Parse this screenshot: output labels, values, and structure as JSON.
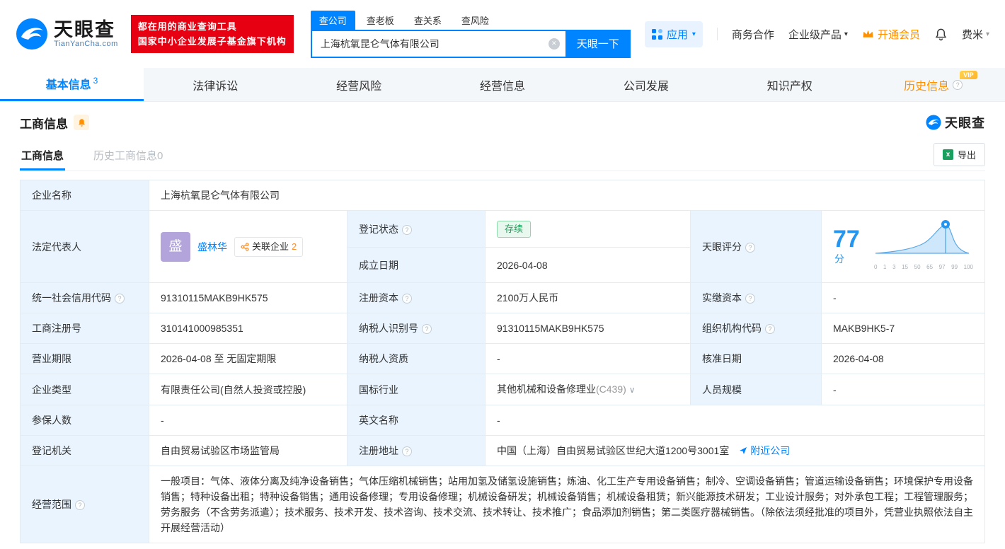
{
  "icons": {
    "caret_down": "▾",
    "chevron_down": "∨",
    "clear": "✕",
    "question": "?",
    "excel_x": "x"
  },
  "colors": {
    "accent_blue": "#0084ff",
    "banner_red": "#e60012",
    "vip_orange": "#ff9000",
    "status_green": "#1fa15a",
    "label_bg": "#e9f4fe"
  },
  "brand": {
    "name": "天眼查",
    "domain": "TianYanCha.com",
    "banner_line1": "都在用的商业查询工具",
    "banner_line2": "国家中小企业发展子基金旗下机构"
  },
  "search": {
    "tabs": [
      "查公司",
      "查老板",
      "查关系",
      "查风险"
    ],
    "value": "上海杭氧昆仑气体有限公司",
    "button": "天眼一下"
  },
  "topnav": {
    "apps": "应用",
    "cooperation": "商务合作",
    "enterprise": "企业级产品",
    "vip": "开通会员",
    "user": "费米"
  },
  "nav_tabs": [
    {
      "label": "基本信息",
      "badge": "3"
    },
    {
      "label": "法律诉讼"
    },
    {
      "label": "经营风险"
    },
    {
      "label": "经营信息"
    },
    {
      "label": "公司发展"
    },
    {
      "label": "知识产权"
    },
    {
      "label": "历史信息",
      "vip": "VIP"
    }
  ],
  "section": {
    "title": "工商信息",
    "subtabs": [
      "工商信息",
      "历史工商信息0"
    ],
    "export_label": "导出"
  },
  "fields": {
    "company_name": {
      "label": "企业名称",
      "value": "上海杭氧昆仑气体有限公司"
    },
    "legal_rep": {
      "label": "法定代表人",
      "name": "盛林华",
      "avatar": "盛",
      "related_label": "关联企业",
      "related_count": "2"
    },
    "reg_status": {
      "label": "登记状态",
      "value": "存续"
    },
    "establish_date": {
      "label": "成立日期",
      "value": "2026-04-08"
    },
    "score": {
      "label": "天眼评分",
      "value": "77",
      "unit": "分",
      "ticks": [
        "0",
        "1",
        "3",
        "15",
        "50",
        "65",
        "97",
        "99",
        "100"
      ]
    },
    "credit_code": {
      "label": "统一社会信用代码",
      "value": "91310115MAKB9HK575"
    },
    "reg_capital": {
      "label": "注册资本",
      "value": "2100万人民币"
    },
    "paid_capital": {
      "label": "实缴资本",
      "value": "-"
    },
    "reg_number": {
      "label": "工商注册号",
      "value": "310141000985351"
    },
    "taxpayer_id": {
      "label": "纳税人识别号",
      "value": "91310115MAKB9HK575"
    },
    "org_code": {
      "label": "组织机构代码",
      "value": "MAKB9HK5-7"
    },
    "business_term": {
      "label": "营业期限",
      "value": "2026-04-08 至 无固定期限"
    },
    "taxpayer_quality": {
      "label": "纳税人资质",
      "value": "-"
    },
    "approval_date": {
      "label": "核准日期",
      "value": "2026-04-08"
    },
    "company_type": {
      "label": "企业类型",
      "value": "有限责任公司(自然人投资或控股)"
    },
    "industry": {
      "label": "国标行业",
      "value": "其他机械和设备修理业",
      "code": "(C439)"
    },
    "staff_size": {
      "label": "人员规模",
      "value": "-"
    },
    "insured_count": {
      "label": "参保人数",
      "value": "-"
    },
    "english_name": {
      "label": "英文名称",
      "value": "-"
    },
    "reg_authority": {
      "label": "登记机关",
      "value": "自由贸易试验区市场监管局"
    },
    "reg_address": {
      "label": "注册地址",
      "value": "中国（上海）自由贸易试验区世纪大道1200号3001室",
      "link": "附近公司"
    },
    "business_scope": {
      "label": "经营范围",
      "value": "一般项目：气体、液体分离及纯净设备销售；气体压缩机械销售；站用加氢及储氢设施销售；炼油、化工生产专用设备销售；制冷、空调设备销售；管道运输设备销售；环境保护专用设备销售；特种设备出租；特种设备销售；通用设备修理；专用设备修理；机械设备研发；机械设备销售；机械设备租赁；新兴能源技术研发；工业设计服务；对外承包工程；工程管理服务；劳务服务（不含劳务派遣）；技术服务、技术开发、技术咨询、技术交流、技术转让、技术推广；食品添加剂销售；第二类医疗器械销售。（除依法须经批准的项目外，凭营业执照依法自主开展经营活动）"
    }
  }
}
